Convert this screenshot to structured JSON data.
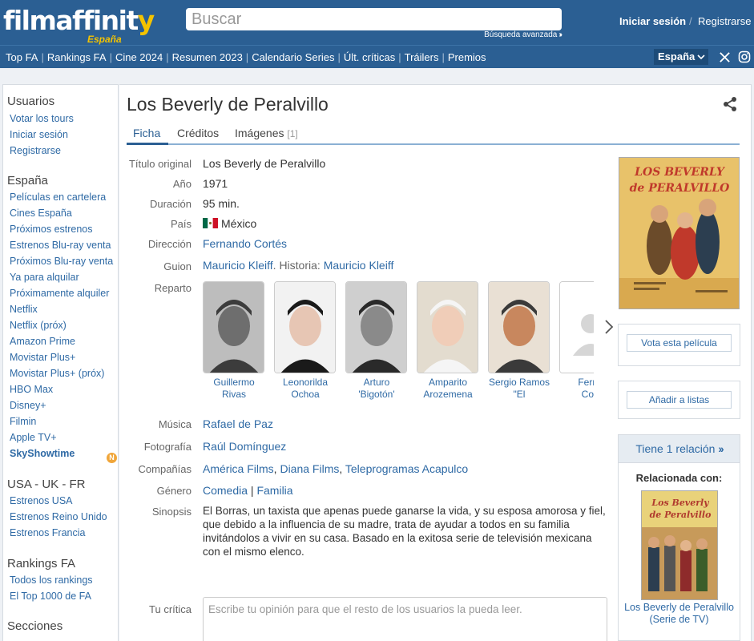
{
  "header": {
    "logo_word_main": "filmaffinit",
    "logo_word_end": "y",
    "logo_region": "España",
    "search_placeholder": "Buscar",
    "advanced_search": "Búsqueda avanzada",
    "login": "Iniciar sesión",
    "separator": "/",
    "register": "Registrarse"
  },
  "nav": {
    "items": [
      "Top FA",
      "Rankings FA",
      "Cine 2024",
      "Resumen 2023",
      "Calendario Series",
      "Últ. críticas",
      "Tráilers",
      "Premios"
    ],
    "country": "España",
    "social": [
      "x-icon",
      "instagram-icon"
    ]
  },
  "sidebar": {
    "sections": [
      {
        "title": "Usuarios",
        "links": [
          "Votar los tours",
          "Iniciar sesión",
          "Registrarse"
        ]
      },
      {
        "title": "España",
        "links": [
          "Películas en cartelera",
          "Cines España",
          "Próximos estrenos",
          "Estrenos Blu-ray venta",
          "Próximos Blu-ray venta",
          "Ya para alquilar",
          "Próximamente alquiler",
          "Netflix",
          "Netflix (próx)",
          "Amazon Prime",
          "Movistar Plus+",
          "Movistar Plus+ (próx)",
          "HBO Max",
          "Disney+",
          "Filmin",
          "Apple TV+",
          "SkyShowtime"
        ]
      },
      {
        "title": "USA - UK - FR",
        "links": [
          "Estrenos USA",
          "Estrenos Reino Unido",
          "Estrenos Francia"
        ]
      },
      {
        "title": "Rankings FA",
        "links": [
          "Todos los rankings",
          "El Top 1000 de FA"
        ]
      },
      {
        "title": "Secciones",
        "links": []
      }
    ],
    "new_badge": "N"
  },
  "movie": {
    "title": "Los Beverly de Peralvillo",
    "tabs": [
      {
        "label": "Ficha",
        "count": ""
      },
      {
        "label": "Créditos",
        "count": ""
      },
      {
        "label": "Imágenes",
        "count": "[1]"
      }
    ],
    "labels": {
      "original_title": "Título original",
      "year": "Año",
      "duration": "Duración",
      "country": "País",
      "director": "Dirección",
      "screenplay": "Guion",
      "cast": "Reparto",
      "music": "Música",
      "photography": "Fotografía",
      "companies": "Compañías",
      "genre": "Género",
      "synopsis": "Sinopsis",
      "review": "Tu crítica"
    },
    "original_title": "Los Beverly de Peralvillo",
    "year": "1971",
    "duration": "95 min.",
    "country": "México",
    "director": "Fernando Cortés",
    "screenplay": "Mauricio Kleiff",
    "story_label": ". Historia: ",
    "story": "Mauricio Kleiff",
    "cast": [
      {
        "line1": "Guillermo",
        "line2": "Rivas"
      },
      {
        "line1": "Leonorilda",
        "line2": "Ochoa"
      },
      {
        "line1": "Arturo",
        "line2": "'Bigotón' Castro"
      },
      {
        "line1": "Amparito",
        "line2": "Arozemena"
      },
      {
        "line1": "Sergio Ramos",
        "line2": "\"El Comanche\""
      },
      {
        "line1": "Ferna",
        "line2": "Cort"
      }
    ],
    "music": "Rafael de Paz",
    "photography": "Raúl Domínguez",
    "companies": [
      "América Films",
      "Diana Films",
      "Teleprogramas Acapulco"
    ],
    "genres": [
      "Comedia",
      "Familia"
    ],
    "synopsis": "El Borras, un taxista que apenas puede ganarse la vida, y su esposa amorosa y fiel, que debido a la influencia de su madre, trata de ayudar a todos en su familia invitándolos a vivir en su casa. Basado en la exitosa serie de televisión mexicana con el mismo elenco.",
    "review_placeholder": "Escribe tu opinión para que el resto de los usuarios la pueda leer."
  },
  "right": {
    "poster_text_1": "LOS BEVERLY",
    "poster_text_2": "de PERALVILLO",
    "vote_button": "Vota esta película",
    "list_button": "Añadir a listas",
    "relations": "Tiene 1 relación",
    "related_with": "Relacionada con:",
    "related_poster_1": "Los Beverly",
    "related_poster_2": "de Peralvillo",
    "related_title": "Los Beverly de Peralvillo (Serie de TV)"
  },
  "colors": {
    "brand": "#2b5f93",
    "logo_yellow": "#f4c300",
    "link": "#2f6aa5",
    "badge": "#f0a63a"
  }
}
